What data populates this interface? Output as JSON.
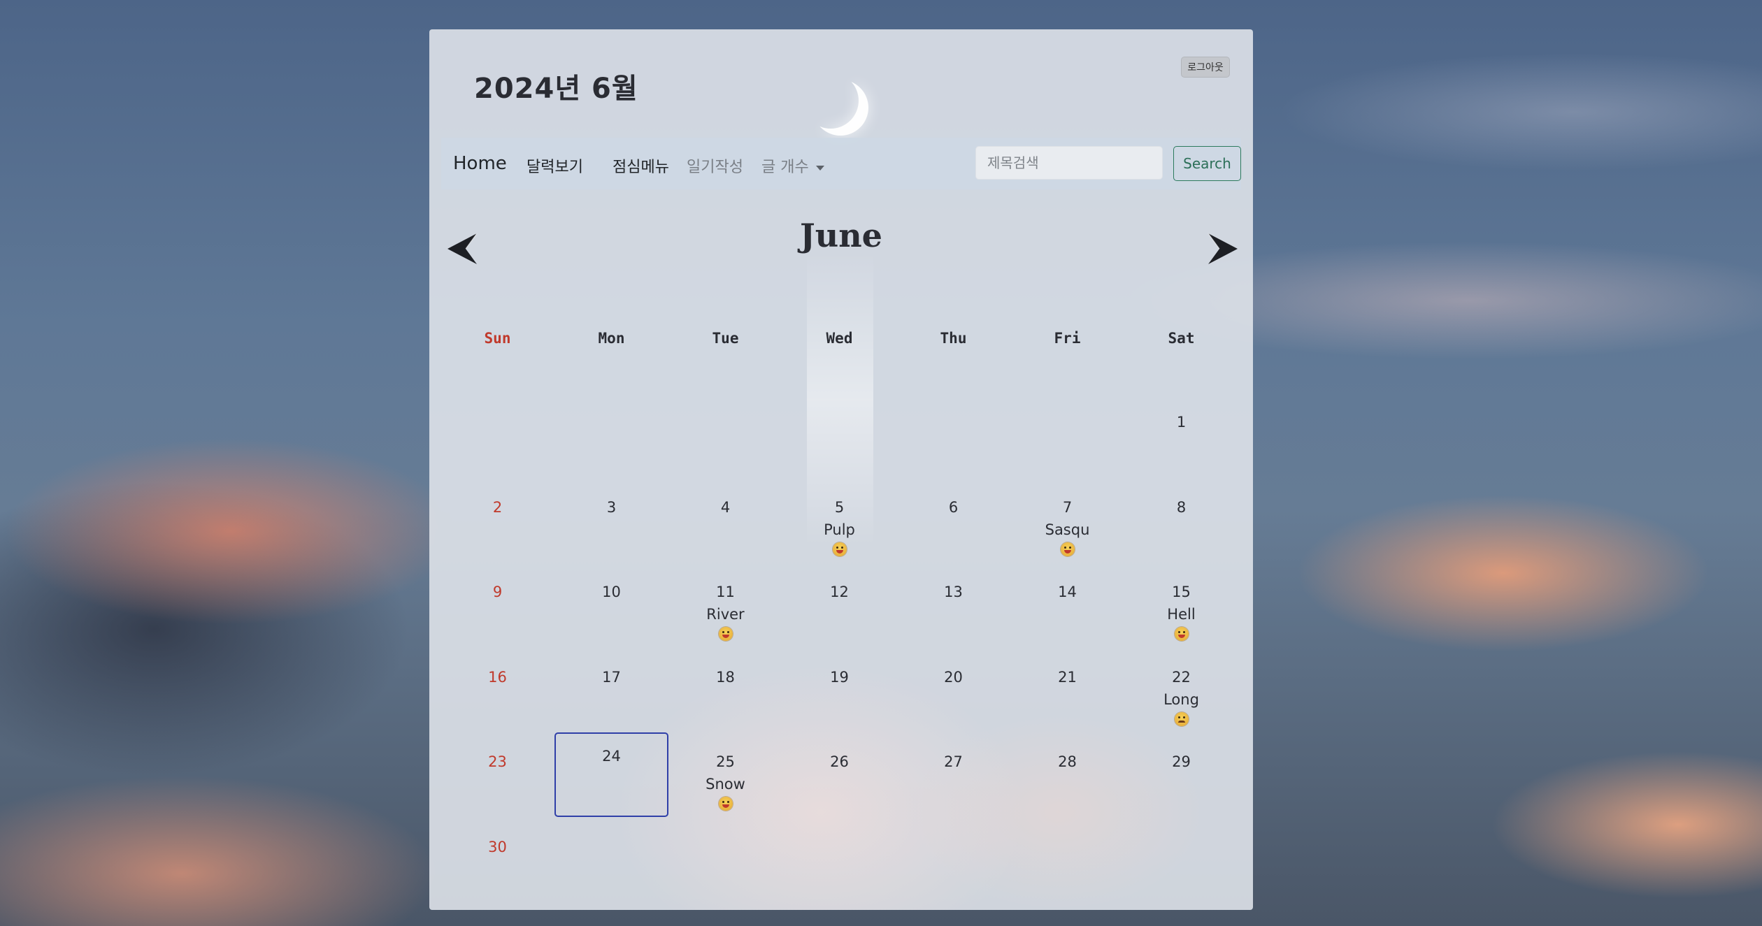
{
  "header": {
    "month_title": "2024년  6월",
    "logout_label": "로그아웃"
  },
  "nav": {
    "brand": "Home",
    "links": [
      "달력보기",
      "점심메뉴",
      "일기작성",
      "글 개수"
    ],
    "search_placeholder": "제목검색",
    "search_button": "Search"
  },
  "calendar": {
    "title": "June",
    "weekdays": [
      "Sun",
      "Mon",
      "Tue",
      "Wed",
      "Thu",
      "Fri",
      "Sat"
    ],
    "today": 24,
    "weeks": [
      [
        null,
        null,
        null,
        null,
        null,
        null,
        {
          "day": "1"
        }
      ],
      [
        {
          "day": "2"
        },
        {
          "day": "3"
        },
        {
          "day": "4"
        },
        {
          "day": "5",
          "title": "Pulp",
          "mood": "happy"
        },
        {
          "day": "6"
        },
        {
          "day": "7",
          "title": "Sasqu",
          "mood": "happy"
        },
        {
          "day": "8"
        }
      ],
      [
        {
          "day": "9"
        },
        {
          "day": "10"
        },
        {
          "day": "11",
          "title": "River",
          "mood": "happy"
        },
        {
          "day": "12"
        },
        {
          "day": "13"
        },
        {
          "day": "14"
        },
        {
          "day": "15",
          "title": "Hell",
          "mood": "happy"
        }
      ],
      [
        {
          "day": "16"
        },
        {
          "day": "17"
        },
        {
          "day": "18"
        },
        {
          "day": "19"
        },
        {
          "day": "20"
        },
        {
          "day": "21"
        },
        {
          "day": "22",
          "title": "Long",
          "mood": "sad"
        }
      ],
      [
        {
          "day": "23"
        },
        {
          "day": "24"
        },
        {
          "day": "25",
          "title": "Snow",
          "mood": "happy"
        },
        {
          "day": "26"
        },
        {
          "day": "27"
        },
        {
          "day": "28"
        },
        {
          "day": "29"
        }
      ],
      [
        {
          "day": "30"
        },
        null,
        null,
        null,
        null,
        null,
        null
      ]
    ]
  },
  "icons": {
    "prev": "arrow-left-icon",
    "next": "arrow-right-icon",
    "dropdown": "caret-down-icon",
    "mood_happy": "happy-face-icon",
    "mood_sad": "sad-face-icon"
  },
  "colors": {
    "sunday": "#c0392b",
    "today_border": "#2f3fa8",
    "search_button": "#2c7a5d"
  }
}
